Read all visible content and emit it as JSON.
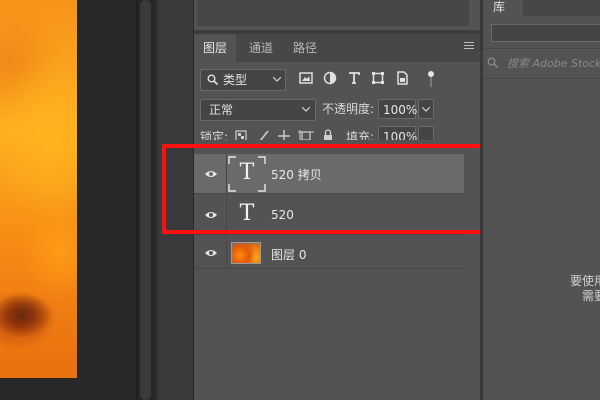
{
  "colors": {
    "panel_bg": "#535353",
    "tab_bar_bg": "#474747",
    "selected_row": "#6a6a6a",
    "highlight": "#ff1010"
  },
  "layers_panel": {
    "tabs": [
      {
        "label": "图层",
        "active": true
      },
      {
        "label": "通道",
        "active": false
      },
      {
        "label": "路径",
        "active": false
      }
    ],
    "menu_icon": "hamburger-menu-icon",
    "filter": {
      "kind_label": "类型",
      "icons": [
        "image-filter-icon",
        "adjustment-filter-icon",
        "type-filter-icon",
        "shape-filter-icon",
        "smart-object-filter-icon"
      ],
      "toggle_icon": "filter-toggle-icon"
    },
    "blend_mode": "正常",
    "opacity_label": "不透明度:",
    "opacity_value": "100%",
    "lock_label": "锁定:",
    "lock_icons": [
      "lock-pixels-icon",
      "lock-paint-icon",
      "lock-position-icon",
      "lock-artboard-icon",
      "lock-all-icon"
    ],
    "fill_label": "填充:",
    "fill_value": "100%",
    "layers": [
      {
        "name": "520 拷贝",
        "type": "text",
        "visible": true,
        "selected": true
      },
      {
        "name": "520",
        "type": "text",
        "visible": true,
        "selected": false
      },
      {
        "name": "图层 0",
        "type": "image",
        "visible": true,
        "selected": false
      }
    ],
    "text_thumb_glyph": "T"
  },
  "library_panel": {
    "tab_label": "库",
    "search_placeholder": "搜索 Adobe Stock",
    "message_line1": "要使用",
    "message_line2": "需要"
  }
}
